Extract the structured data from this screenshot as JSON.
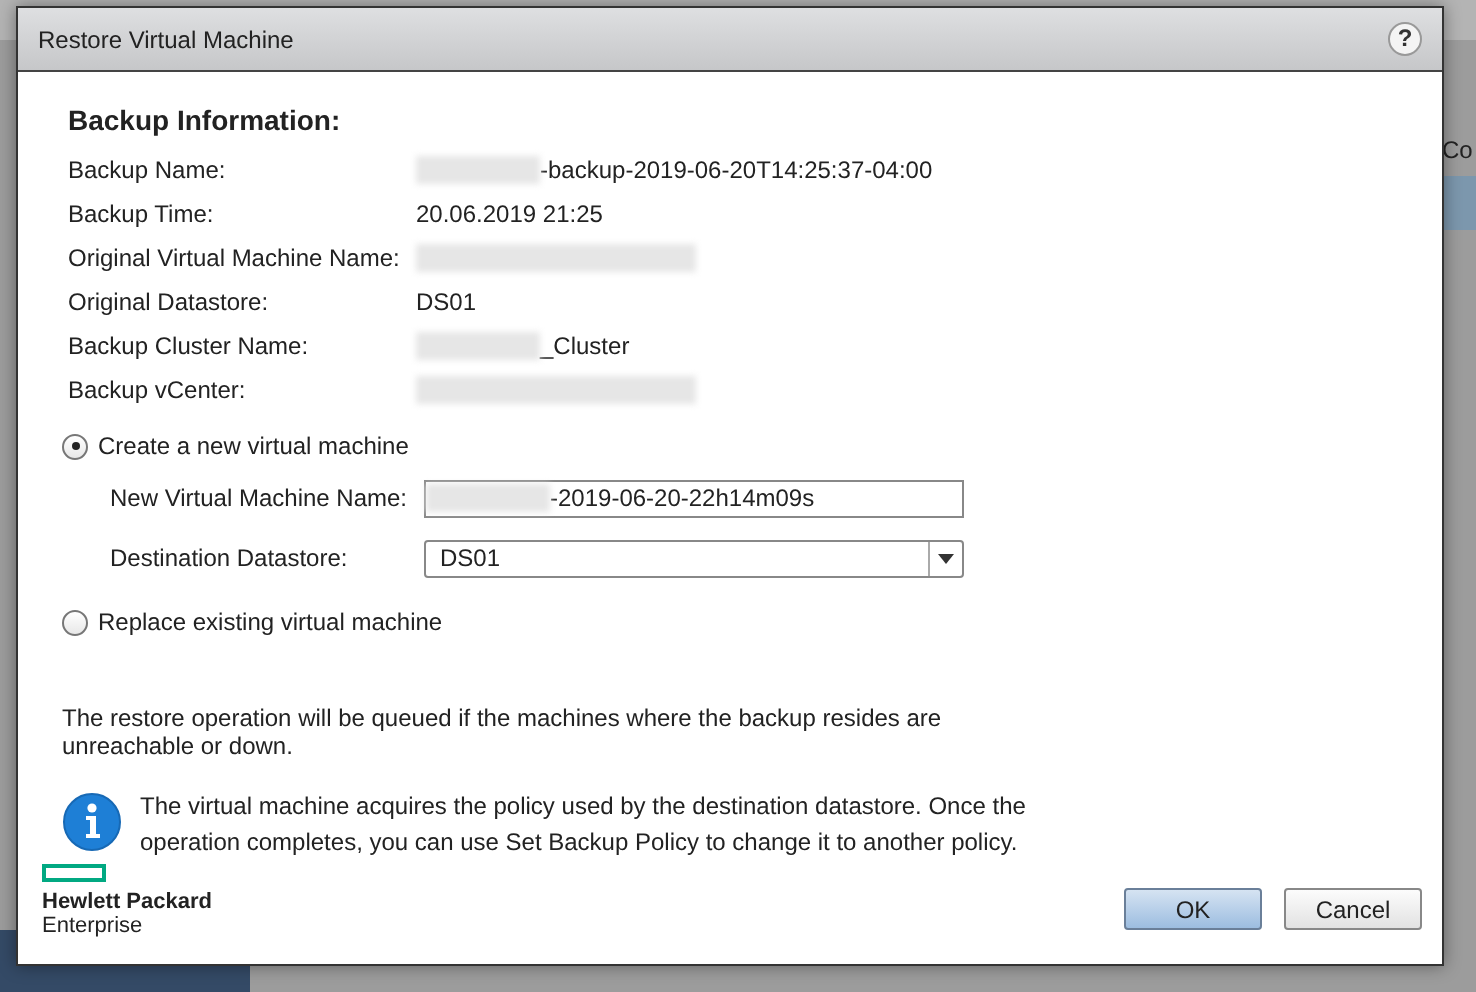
{
  "background": {
    "column_header": "Co"
  },
  "dialog": {
    "title": "Restore Virtual Machine",
    "help": "?",
    "heading": "Backup Information:",
    "info": [
      {
        "label": "Backup Name:",
        "redacted": true,
        "value": "-backup-2019-06-20T14:25:37-04:00"
      },
      {
        "label": "Backup Time:",
        "value": "20.06.2019 21:25"
      },
      {
        "label": "Original Virtual Machine Name:",
        "redacted": true
      },
      {
        "label": "Original Datastore:",
        "value": "DS01"
      },
      {
        "label": "Backup Cluster Name:",
        "redacted": true,
        "value": "_Cluster"
      },
      {
        "label": "Backup vCenter:",
        "redacted": true
      }
    ],
    "options": [
      {
        "label": "Create a new virtual machine",
        "selected": true,
        "fields": [
          {
            "kind": "text",
            "label": "New Virtual Machine Name:",
            "redacted": true,
            "value": "-2019-06-20-22h14m09s"
          },
          {
            "kind": "dropdown",
            "label": "Destination Datastore:",
            "value": "DS01"
          }
        ]
      },
      {
        "label": "Replace existing virtual machine",
        "selected": false
      }
    ],
    "note": "The restore operation will be queued if the machines where the backup resides are unreachable or down.",
    "info_message": "The virtual machine acquires the policy used by the destination datastore. Once the operation completes, you can use Set Backup Policy to change it to another policy.",
    "brand": {
      "line1": "Hewlett Packard",
      "line2": "Enterprise"
    },
    "buttons": [
      {
        "label": "OK",
        "kind": "primary"
      },
      {
        "label": "Cancel",
        "kind": "secondary"
      }
    ]
  }
}
